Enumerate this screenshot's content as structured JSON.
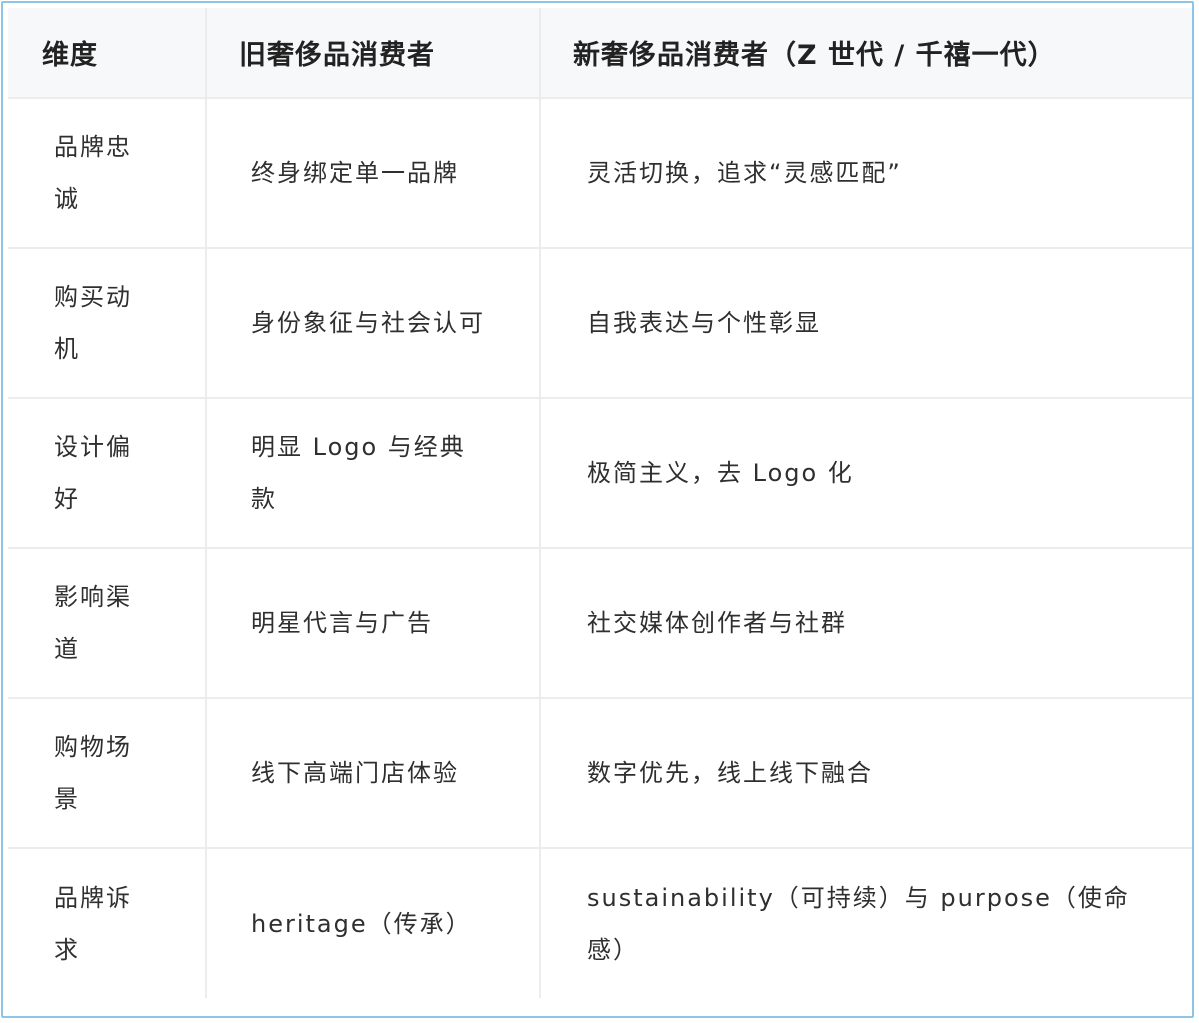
{
  "table": {
    "headers": [
      "维度",
      "旧奢侈品消费者",
      "新奢侈品消费者（Z 世代 / 千禧一代）"
    ],
    "rows": [
      {
        "dimension": "品牌忠诚",
        "old": "终身绑定单一品牌",
        "new": "灵活切换，追求“灵感匹配”"
      },
      {
        "dimension": "购买动机",
        "old": "身份象征与社会认可",
        "new": "自我表达与个性彰显"
      },
      {
        "dimension": "设计偏好",
        "old": "明显 Logo 与经典款",
        "new": "极简主义，去 Logo 化"
      },
      {
        "dimension": "影响渠道",
        "old": "明星代言与广告",
        "new": "社交媒体创作者与社群"
      },
      {
        "dimension": "购物场景",
        "old": "线下高端门店体验",
        "new": "数字优先，线上线下融合"
      },
      {
        "dimension": "品牌诉求",
        "old": "heritage（传承）",
        "new": "sustainability（可持续）与 purpose（使命感）"
      }
    ]
  },
  "colors": {
    "frame_border": "#8ec5e6",
    "header_background": "#f7f8fa",
    "grid_line": "#ececec"
  }
}
